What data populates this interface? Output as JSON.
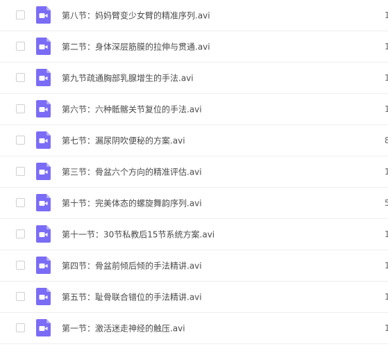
{
  "colors": {
    "icon_purple": "#7b6cf6",
    "icon_fold": "#b4acfa",
    "divider": "#eeeeee",
    "text": "#4a4a4a"
  },
  "files": [
    {
      "name": "第八节：妈妈臂变少女臂的精准序列.avi",
      "icon": "video-file-icon",
      "extra": "1"
    },
    {
      "name": "第二节：身体深层筋膜的拉伸与贯通.avi",
      "icon": "video-file-icon",
      "extra": "1"
    },
    {
      "name": "第九节疏通胸部乳腺增生的手法.avi",
      "icon": "video-file-icon",
      "extra": "1"
    },
    {
      "name": "第六节：六种骶髂关节复位的手法.avi",
      "icon": "video-file-icon",
      "extra": "1"
    },
    {
      "name": "第七节：漏尿阴吹便秘的方案.avi",
      "icon": "video-file-icon",
      "extra": "8"
    },
    {
      "name": "第三节：骨盆六个方向的精准评估.avi",
      "icon": "video-file-icon",
      "extra": "1"
    },
    {
      "name": "第十节：完美体态的螺旋舞韵序列.avi",
      "icon": "video-file-icon",
      "extra": "5"
    },
    {
      "name": "第十一节：30节私教后15节系统方案.avi",
      "icon": "video-file-icon",
      "extra": "1"
    },
    {
      "name": "第四节：骨盆前倾后倾的手法精讲.avi",
      "icon": "video-file-icon",
      "extra": "1"
    },
    {
      "name": "第五节：耻骨联合错位的手法精讲.avi",
      "icon": "video-file-icon",
      "extra": "1"
    },
    {
      "name": "第一节：激活迷走神经的触压.avi",
      "icon": "video-file-icon",
      "extra": "1"
    }
  ]
}
